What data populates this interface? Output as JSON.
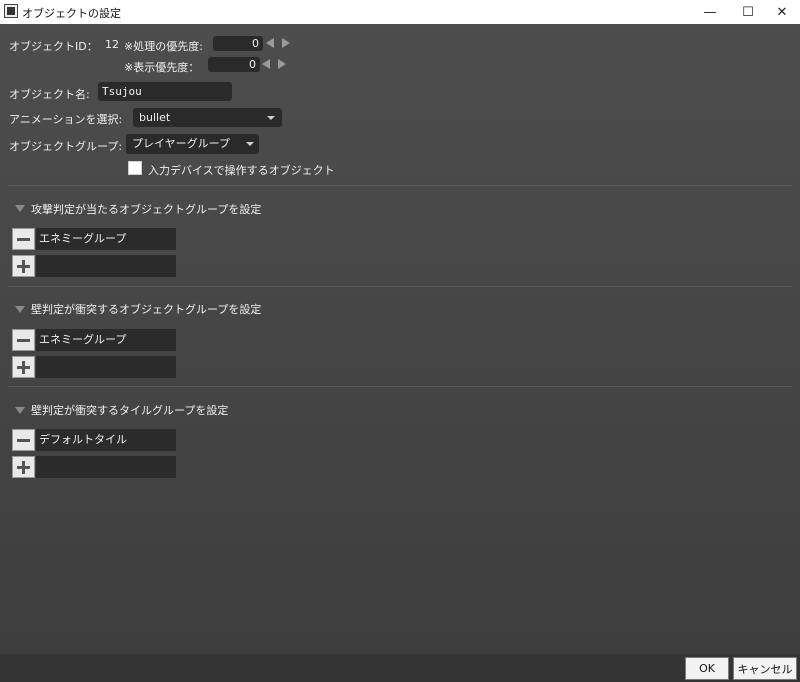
{
  "window": {
    "title": "オブジェクトの設定",
    "minimize_glyph": "—",
    "maximize_glyph": "☐",
    "close_glyph": "✕"
  },
  "form": {
    "object_id_label": "オブジェクトID：",
    "object_id_value": "12",
    "process_priority_label": "※処理の優先度:",
    "process_priority_value": "0",
    "display_priority_label": "※表示優先度：",
    "display_priority_value": "0",
    "object_name_label": "オブジェクト名:",
    "object_name_value": "Tsujou",
    "animation_label": "アニメーションを選択:",
    "animation_value": "bullet",
    "object_group_label": "オブジェクトグループ:",
    "object_group_value": "プレイヤーグループ",
    "input_device_checkbox_label": "入力デバイスで操作するオブジェクト",
    "input_device_checked": false
  },
  "sections": [
    {
      "title": "攻撃判定が当たるオブジェクトグループを設定",
      "group": "エネミーグループ"
    },
    {
      "title": "壁判定が衝突するオブジェクトグループを設定",
      "group": "エネミーグループ"
    },
    {
      "title": "壁判定が衝突するタイルグループを設定",
      "group": "デフォルトタイル"
    }
  ],
  "buttons": {
    "ok": "OK",
    "cancel": "キャンセル"
  },
  "colors": {
    "background_top": "#4d4d4d",
    "background_bottom": "#3e3e3e",
    "field": "#2a2a2a",
    "text": "#f0f0f0"
  }
}
